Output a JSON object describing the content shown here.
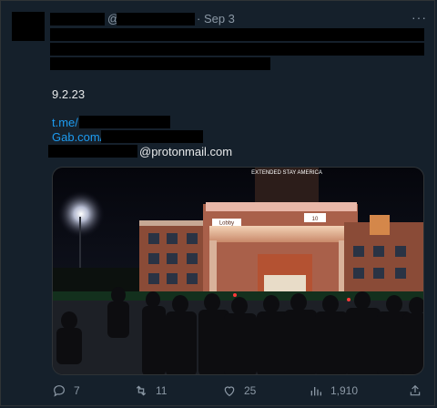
{
  "header": {
    "at": "@",
    "date": "· Sep 3",
    "more": "···"
  },
  "tweet": {
    "date_line": "9.2.23",
    "link1": "t.me/",
    "link2": "Gab.com/",
    "email_suffix": "@protonmail.com"
  },
  "photo": {
    "hotel_sign": "EXTENDED STAY AMERICA",
    "lobby_sign": "Lobby",
    "number_sign": "10"
  },
  "actions": {
    "replies": "7",
    "retweets": "11",
    "likes": "25",
    "views": "1,910"
  },
  "colors": {
    "background": "#15202b",
    "link": "#1d9bf0",
    "muted": "#8b98a5"
  }
}
